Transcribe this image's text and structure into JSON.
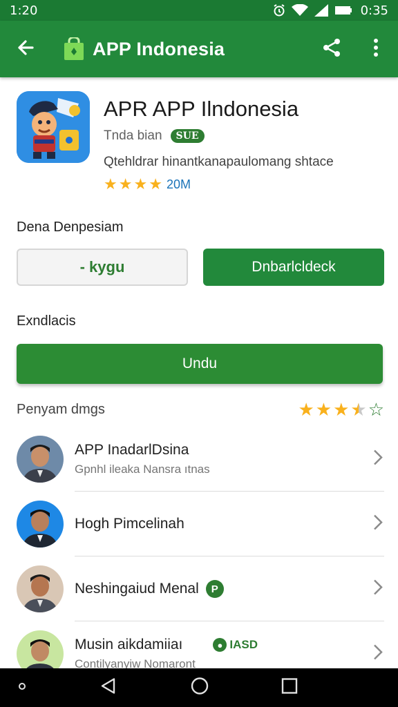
{
  "status_bar": {
    "time": "1:20",
    "clock": "0:35"
  },
  "app_bar": {
    "title": "APP Indonesia",
    "icons": [
      "back-arrow-icon",
      "store-bag-icon",
      "share-icon",
      "more-vert-icon"
    ]
  },
  "app": {
    "title": "APR APP Ilndonesia",
    "developer": "Tnda bian",
    "badge": "SUE",
    "description": "Qtehldrar hinantkanapaulomang shtace",
    "rating_stars": 4,
    "rating_count": "20M"
  },
  "sections": {
    "install_label": "Dena Denpesiam",
    "outline_button": "- kygu",
    "filled_button": "Dnbarlcldeck",
    "extra_label": "Exndlacis",
    "wide_button": "Undu",
    "reviews_label": "Penyam dmgs",
    "reviews_stars": 3.5
  },
  "list": [
    {
      "title": "APP InadarlDsina",
      "subtitle": "Gpnhl ileaka Nansra   ıtnas",
      "badge": "",
      "tag": ""
    },
    {
      "title": "Hogh Pimcelinah",
      "subtitle": "",
      "badge": "",
      "tag": ""
    },
    {
      "title": "Neshingaiud Menal",
      "subtitle": "",
      "badge": "P",
      "tag": ""
    },
    {
      "title": "Musin aikdamiiaı",
      "subtitle": "Contilyanyiw Nomaront",
      "badge": "",
      "tag": "IASD"
    }
  ],
  "colors": {
    "status_bar": "#1b7a33",
    "app_bar": "#22893b",
    "accent_green": "#2e7d32",
    "star": "#f9b11d"
  }
}
